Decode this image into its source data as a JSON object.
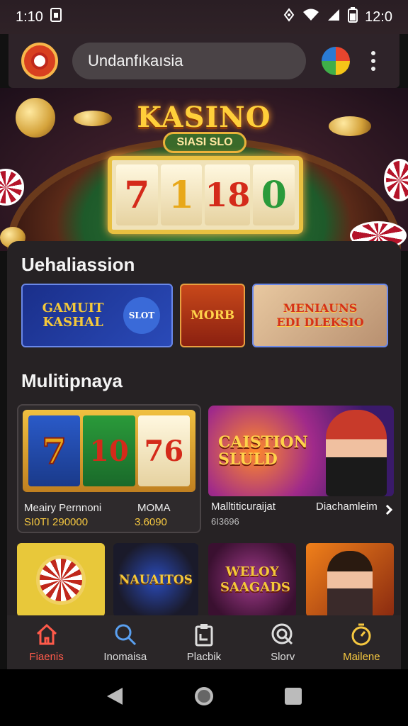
{
  "status_bar": {
    "time": "1:10",
    "clock_right": "12:0",
    "icons": [
      "sim-card-icon",
      "signal-icon",
      "wifi-icon",
      "cellular-icon",
      "battery-icon"
    ]
  },
  "browser": {
    "url_text": "Undanfıkaısia",
    "icons": [
      "brand-logo-icon",
      "profile-avatar-icon",
      "kebab-menu-icon"
    ]
  },
  "hero": {
    "title": "KASINO",
    "subtitle": "SIASI SLO",
    "reels": [
      "7",
      "1",
      "18",
      "0"
    ]
  },
  "section1": {
    "title": "Uehaliassion",
    "tiles": [
      {
        "label": "GAMUIT KASHAL",
        "sub": "SLOT"
      },
      {
        "label": "MORB"
      },
      {
        "label": "MENIAUNS EDI DLEKSIO"
      }
    ]
  },
  "section2": {
    "title": "Mulitipnaya",
    "featured": [
      {
        "reels": [
          "7",
          "10",
          "76"
        ],
        "name": "Meairy Pernnoni",
        "tag": "MOMA",
        "price": "SI0TI 290000",
        "price2": "3.6090"
      },
      {
        "label": "CAISTION SLULD",
        "name": "Malltiticuraijat",
        "sub": "6I3696",
        "tag": "Diachamleim"
      }
    ]
  },
  "row3": [
    {
      "label": ""
    },
    {
      "label": "NAUAITOS"
    },
    {
      "label": "WELOY SAAGADS"
    },
    {
      "label": ""
    }
  ],
  "bottom_nav": [
    {
      "label": "Fiaenis",
      "icon": "home-icon"
    },
    {
      "label": "Inomaisa",
      "icon": "search-icon"
    },
    {
      "label": "Placbik",
      "icon": "clipboard-icon"
    },
    {
      "label": "Slorv",
      "icon": "magnify-circle-icon"
    },
    {
      "label": "Mailene",
      "icon": "timer-icon"
    }
  ],
  "colors": {
    "accent_red": "#ff5a4a",
    "accent_gold": "#f6c840",
    "panel_bg": "#262224"
  }
}
